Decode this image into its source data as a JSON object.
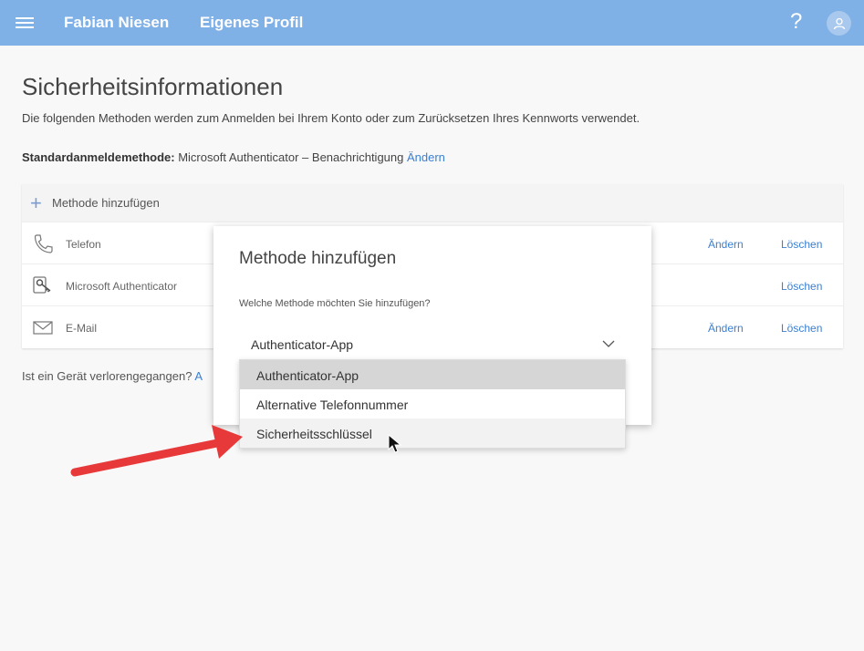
{
  "header": {
    "user_name": "Fabian Niesen",
    "profile_label": "Eigenes Profil",
    "help_label": "?",
    "accent_color": "#7fb0e6"
  },
  "page": {
    "title": "Sicherheitsinformationen",
    "description": "Die folgenden Methoden werden zum Anmelden bei Ihrem Konto oder zum Zurücksetzen Ihres Kennworts verwendet.",
    "default_label": "Standardanmeldemethode:",
    "default_value": "Microsoft Authenticator – Benachrichtigung",
    "default_change": "Ändern"
  },
  "methods": {
    "add_label": "Methode hinzufügen",
    "rows": [
      {
        "name": "Telefon",
        "icon": "phone-icon",
        "edit": "Ändern",
        "delete": "Löschen"
      },
      {
        "name": "Microsoft Authenticator",
        "icon": "authenticator-icon",
        "edit": "",
        "delete": "Löschen"
      },
      {
        "name": "E-Mail",
        "icon": "mail-icon",
        "edit": "Ändern",
        "delete": "Löschen"
      }
    ]
  },
  "lost_device": {
    "text": "Ist ein Gerät verlorengegangen?",
    "link": "A"
  },
  "dialog": {
    "title": "Methode hinzufügen",
    "question": "Welche Methode möchten Sie hinzufügen?",
    "selected": "Authenticator-App",
    "options": [
      "Authenticator-App",
      "Alternative Telefonnummer",
      "Sicherheitsschlüssel"
    ]
  },
  "annotation_arrow_color": "#e8393a"
}
